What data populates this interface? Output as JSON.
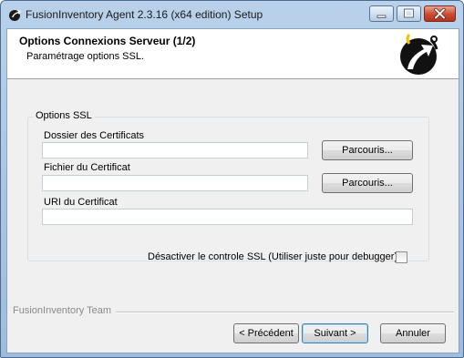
{
  "window": {
    "title": "FusionInventory Agent 2.3.16 (x64 edition) Setup"
  },
  "header": {
    "title": "Options Connexions Serveur (1/2)",
    "subtitle": "Paramétrage options SSL."
  },
  "ssl_group": {
    "label": "Options SSL",
    "cert_dir": {
      "label": "Dossier des Certificats",
      "value": "",
      "button": "Parcouris..."
    },
    "cert_file": {
      "label": "Fichier du Certificat",
      "value": "",
      "button": "Parcouris..."
    },
    "cert_uri": {
      "label": "URI du Certificat",
      "value": ""
    }
  },
  "disable_ssl_check": {
    "label": "Désactiver le controle SSL (Utiliser juste pour debugger)",
    "checked": false
  },
  "footer": {
    "brand": "FusionInventory Team",
    "back_label": "< Précédent",
    "next_label": "Suivant >",
    "cancel_label": "Annuler"
  },
  "icons": {
    "app": "fusioninventory-app-icon",
    "logo": "fusioninventory-logo-icon",
    "minimize": "minimize-icon",
    "maximize": "maximize-icon",
    "close": "close-icon"
  },
  "colors": {
    "title_gradient_top": "#b9d1ea",
    "close_button": "#c94a31",
    "logo_arrow": "#f5c400"
  }
}
